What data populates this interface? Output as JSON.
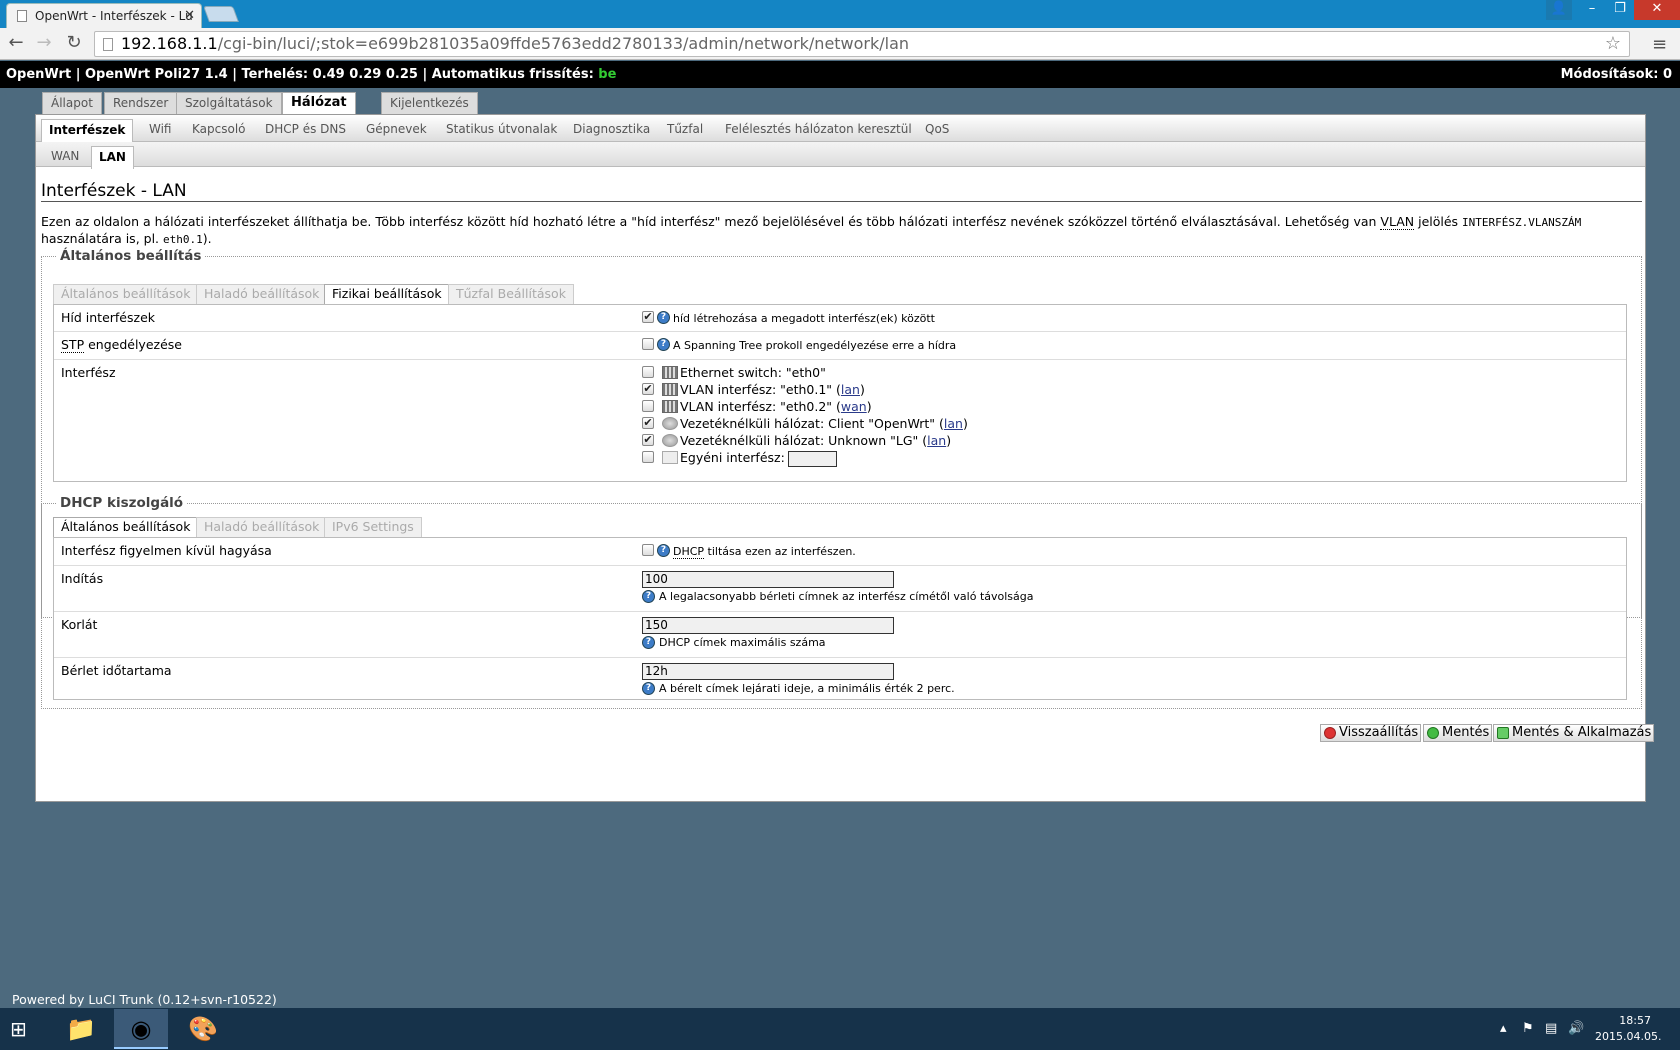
{
  "browser": {
    "tab_title": "OpenWrt - Interfészek - Lu",
    "url_host": "192.168.1.1",
    "url_path": "/cgi-bin/luci/;stok=e699b281035a09ffde5763edd2780133/admin/network/network/lan"
  },
  "statusbar": {
    "prefix": "OpenWrt | OpenWrt Poli27 1.4 | Terhelés: 0.49 0.29 0.25 | Automatikus frissítés: ",
    "refresh_state": "be",
    "changes": "Módosítások: 0"
  },
  "top_tabs": [
    "Állapot",
    "Rendszer",
    "Szolgáltatások",
    "Hálózat",
    "Kijelentkezés"
  ],
  "sub_tabs": [
    "Interfészek",
    "Wifi",
    "Kapcsoló",
    "DHCP és DNS",
    "Gépnevek",
    "Statikus útvonalak",
    "Diagnosztika",
    "Tűzfal",
    "Felélesztés hálózaton keresztül",
    "QoS"
  ],
  "iface_tabs": [
    "WAN",
    "LAN"
  ],
  "page": {
    "title": "Interfészek - LAN",
    "desc_part1": "Ezen az oldalon a hálózati interfészeket állíthatja be. Több interfész között híd hozható létre a \"híd interfész\" mező bejelölésével és több hálózati interfész nevének szóközzel történő elválasztásával. Lehetőség van ",
    "desc_abbr": "VLAN",
    "desc_part2": " jelölés ",
    "desc_code": "INTERFÉSZ.VLANSZÁM",
    "desc_part3": " használatára is, pl. ",
    "desc_code2": "eth0.1",
    "desc_part4": ")."
  },
  "general": {
    "legend": "Általános beállítás",
    "tabs": [
      "Általános beállítások",
      "Haladó beállítások",
      "Fizikai beállítások",
      "Tűzfal Beállítások"
    ],
    "bridge_label": "Híd interfészek",
    "bridge_desc": "híd létrehozása a megadott interfész(ek) között",
    "stp_abbr": "STP",
    "stp_label_rest": " engedélyezése",
    "stp_desc": "A Spanning Tree prokoll engedélyezése erre a hídra",
    "iface_label": "Interfész",
    "interfaces": [
      {
        "name": "Ethernet switch: \"eth0\"",
        "checked": false,
        "net": ""
      },
      {
        "name": "VLAN interfész: \"eth0.1\" (",
        "checked": true,
        "net": "lan"
      },
      {
        "name": "VLAN interfész: \"eth0.2\" (",
        "checked": false,
        "net": "wan"
      },
      {
        "name": "Vezetéknélküli hálózat: Client \"OpenWrt\" (",
        "checked": true,
        "net": "lan"
      },
      {
        "name": "Vezetéknélküli hálózat: Unknown \"LG\" (",
        "checked": true,
        "net": "lan"
      },
      {
        "name": "Egyéni interfész:",
        "checked": false,
        "net": ""
      }
    ]
  },
  "dhcp": {
    "legend": "DHCP kiszolgáló",
    "tabs": [
      "Általános beállítások",
      "Haladó beállítások",
      "IPv6 Settings"
    ],
    "ignore_label": "Interfész figyelmen kívül hagyása",
    "ignore_abbr": "DHCP",
    "ignore_desc_rest": " tiltása ezen az interfészen.",
    "start_label": "Indítás",
    "start_value": "100",
    "start_hint": "A legalacsonyabb bérleti címnek az interfész címétől való távolsága",
    "limit_label": "Korlát",
    "limit_value": "150",
    "limit_hint": "DHCP címek maximális száma",
    "lease_label": "Bérlet időtartama",
    "lease_value": "12h",
    "lease_hint": "A bérelt címek lejárati ideje, a minimális érték 2 perc."
  },
  "buttons": {
    "reset": "Visszaállítás",
    "save": "Mentés",
    "apply": "Mentés & Alkalmazás"
  },
  "footer": "Powered by LuCI Trunk (0.12+svn-r10522)",
  "clock": {
    "time": "18:57",
    "date": "2015.04.05."
  }
}
